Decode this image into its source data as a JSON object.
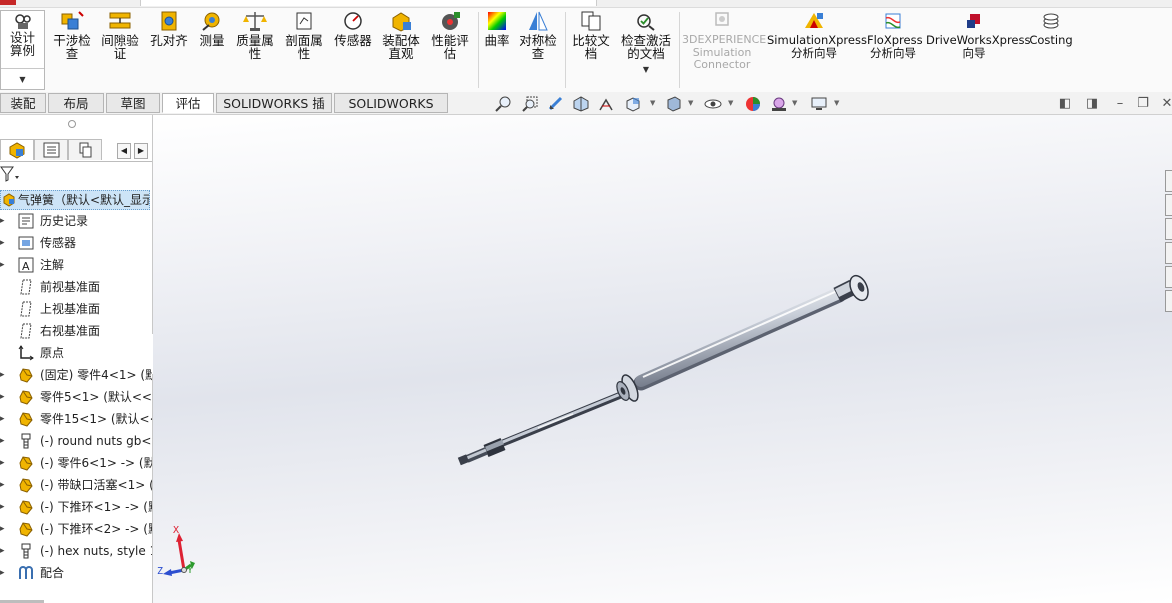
{
  "ribbon": {
    "design_study": "设计算例",
    "buttons": [
      {
        "label": "干涉检查",
        "icon": "interference-check-icon"
      },
      {
        "label": "间隙验证",
        "icon": "clearance-verification-icon"
      },
      {
        "label": "孔对齐",
        "icon": "hole-alignment-icon"
      },
      {
        "label": "测量",
        "icon": "measure-icon"
      },
      {
        "label": "质量属性",
        "icon": "mass-properties-icon"
      },
      {
        "label": "剖面属性",
        "icon": "section-properties-icon"
      },
      {
        "label": "传感器",
        "icon": "sensor-icon"
      },
      {
        "label": "装配体直观",
        "icon": "assembly-visualization-icon"
      },
      {
        "label": "性能评估",
        "icon": "performance-evaluation-icon"
      },
      {
        "label": "曲率",
        "icon": "curvature-icon"
      },
      {
        "label": "对称检查",
        "icon": "symmetry-check-icon"
      },
      {
        "label": "比较文档",
        "icon": "compare-documents-icon"
      },
      {
        "label": "检查激活的文档",
        "icon": "check-active-document-icon"
      }
    ],
    "addins": [
      {
        "label": "3DEXPERIENCE Simulation Connector",
        "icon": "3dexperience-icon",
        "disabled": true
      },
      {
        "label": "SimulationXpress 分析向导",
        "icon": "simulationxpress-icon"
      },
      {
        "label": "FloXpress 分析向导",
        "icon": "floxpress-icon"
      },
      {
        "label": "DriveWorksXpress 向导",
        "icon": "driveworksxpress-icon"
      },
      {
        "label": "Costing",
        "icon": "costing-icon"
      }
    ]
  },
  "command_tabs": [
    "装配体",
    "布局",
    "草图",
    "评估",
    "SOLIDWORKS 插件",
    "SOLIDWORKS MBD"
  ],
  "active_tab": "评估",
  "tree": {
    "root": "气弹簧（默认<默认_显示",
    "items": [
      {
        "label": "历史记录",
        "icon": "history-icon"
      },
      {
        "label": "传感器",
        "icon": "sensor-folder-icon"
      },
      {
        "label": "注解",
        "icon": "annotations-icon"
      },
      {
        "label": "前视基准面",
        "icon": "plane-icon"
      },
      {
        "label": "上视基准面",
        "icon": "plane-icon"
      },
      {
        "label": "右视基准面",
        "icon": "plane-icon"
      },
      {
        "label": "原点",
        "icon": "origin-icon"
      },
      {
        "label": "(固定) 零件4<1> (默",
        "icon": "part-icon"
      },
      {
        "label": "零件5<1> (默认<<默",
        "icon": "part-icon"
      },
      {
        "label": "零件15<1> (默认<<",
        "icon": "part-icon"
      },
      {
        "label": "(-) round nuts gb<",
        "icon": "toolbox-part-icon"
      },
      {
        "label": "(-) 零件6<1> -> (默",
        "icon": "part-icon"
      },
      {
        "label": "(-) 带缺口活塞<1> (",
        "icon": "part-icon"
      },
      {
        "label": "(-) 下推环<1> -> (默",
        "icon": "part-icon"
      },
      {
        "label": "(-) 下推环<2> -> (默",
        "icon": "part-icon"
      },
      {
        "label": "(-) hex nuts, style 1",
        "icon": "toolbox-part-icon"
      },
      {
        "label": "配合",
        "icon": "mates-icon"
      }
    ]
  },
  "triad": {
    "x": "X",
    "y": "Y",
    "z": "Z"
  },
  "colors": {
    "selection": "#cde4f7",
    "tab_active": "#ffffff"
  }
}
